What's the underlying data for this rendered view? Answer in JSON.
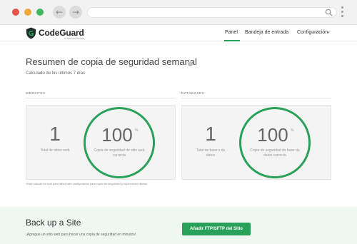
{
  "browser": {
    "back_glyph": "←",
    "forward_glyph": "→",
    "icons": [
      "search-icon",
      "kebab-menu-icon"
    ]
  },
  "header": {
    "logo_text": "CodeGuard",
    "logo_sub": "by SECURITYNAME",
    "nav": {
      "panel": "Panel",
      "bandeja": "Bandeja de entrada",
      "config": "Configuración",
      "config_caret": "▾"
    },
    "accent_color": "#2aa15a"
  },
  "main": {
    "title": "Resumen de copia de seguridad semanal",
    "help_glyph": "?",
    "subtitle": "Calculado de los últimos 7 días",
    "websites": {
      "section_label": "WEBSITES",
      "count": "1",
      "count_label": "Total de sitios web",
      "percent": "100",
      "percent_sign": "%",
      "percent_label": "Copia de seguridad de sitio web correcta"
    },
    "databases": {
      "section_label": "DATABASES",
      "count": "1",
      "count_label": "Total de base s de datos",
      "percent": "100",
      "percent_sign": "%",
      "percent_label": "Copia de seguridad de base de datos correcta"
    },
    "footnote": "*Este cálculo es sólo para sitios web configurados para copia de seguridad y supervisión diarias."
  },
  "banner": {
    "title": "Back up a Site",
    "subtitle": "¡Agregue un sitio web para hacer una copia de seguridad en minutos!",
    "button_label": "Añadir FTP/SFTP del Sitio"
  }
}
